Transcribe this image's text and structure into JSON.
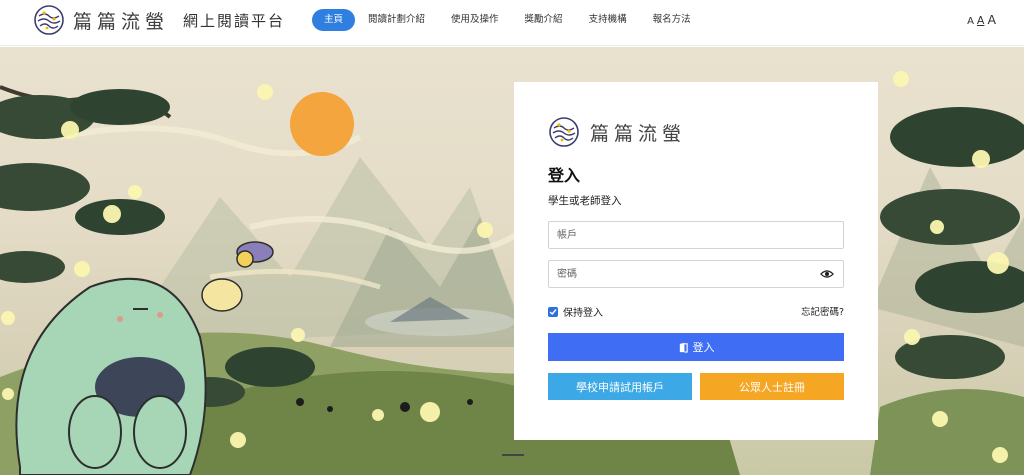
{
  "header": {
    "logo_name": "篇篇流螢",
    "logo_subtitle": "網上閱讀平台",
    "nav": [
      {
        "label": "主頁",
        "active": true
      },
      {
        "label": "閱讀計劃介紹"
      },
      {
        "label": "使用及操作"
      },
      {
        "label": "獎勵介紹"
      },
      {
        "label": "支持機構"
      },
      {
        "label": "報名方法"
      }
    ],
    "font_size_controls": [
      "A",
      "A",
      "A"
    ]
  },
  "login": {
    "logo_name": "篇篇流螢",
    "title": "登入",
    "subtitle": "學生或老師登入",
    "account_placeholder": "帳戶",
    "password_placeholder": "密碼",
    "remember_label": "保持登入",
    "remember_checked": true,
    "forgot_label": "忘記密碼?",
    "login_button": "登入",
    "trial_button": "學校申請試用帳戶",
    "public_button": "公眾人士註冊"
  },
  "colors": {
    "nav_active": "#2f7fe0",
    "login_button": "#3f6ef5",
    "trial_button": "#3ca9e6",
    "public_button": "#f5a623"
  },
  "icons": [
    "logo-mark-icon",
    "eye-icon",
    "checkbox-check-icon",
    "door-enter-icon"
  ]
}
